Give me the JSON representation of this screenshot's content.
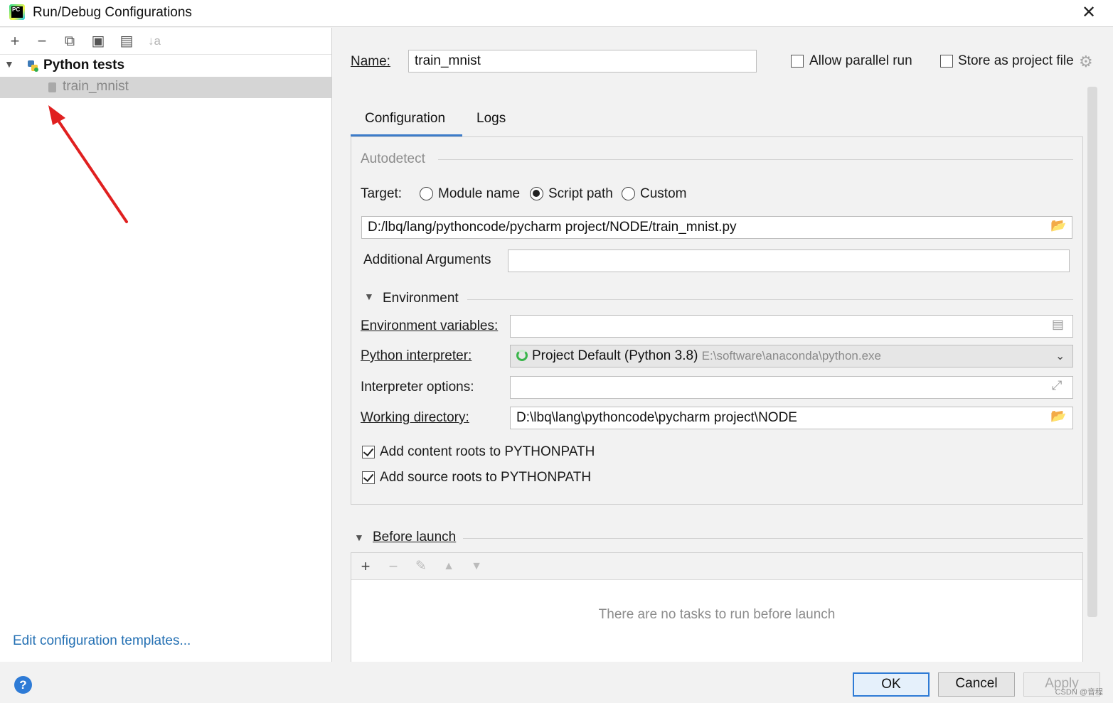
{
  "window": {
    "title": "Run/Debug Configurations",
    "close_label": "✕"
  },
  "left": {
    "toolbar": {
      "add": "+",
      "remove": "−",
      "copy": "⧉",
      "save": "▣",
      "folder": "▤",
      "sort": "↓a"
    },
    "tree": {
      "group_label": "Python tests",
      "item_label": "train_mnist"
    },
    "edit_templates_link": "Edit configuration templates..."
  },
  "form": {
    "name_label": "Name:",
    "name_value": "train_mnist",
    "allow_parallel_label": "Allow parallel run",
    "allow_parallel_checked": false,
    "store_project_label": "Store as project file",
    "store_project_checked": false,
    "tabs": [
      "Configuration",
      "Logs"
    ],
    "active_tab": "Configuration",
    "autodetect_label": "Autodetect",
    "target_label": "Target:",
    "target_options": [
      "Module name",
      "Script path",
      "Custom"
    ],
    "target_selected": "Script path",
    "script_path": "D:/lbq/lang/pythoncode/pycharm project/NODE/train_mnist.py",
    "additional_args_label": "Additional Arguments",
    "additional_args_value": "",
    "environment_label": "Environment",
    "env_vars_label": "Environment variables:",
    "env_vars_value": "",
    "python_interpreter_label": "Python interpreter:",
    "python_interpreter_value": "Project Default (Python 3.8)",
    "python_interpreter_path": "E:\\software\\anaconda\\python.exe",
    "interpreter_options_label": "Interpreter options:",
    "interpreter_options_value": "",
    "working_dir_label": "Working directory:",
    "working_dir_value": "D:\\lbq\\lang\\pythoncode\\pycharm project\\NODE",
    "add_content_roots_label": "Add content roots to PYTHONPATH",
    "add_content_roots_checked": true,
    "add_source_roots_label": "Add source roots to PYTHONPATH",
    "add_source_roots_checked": true,
    "before_launch_label": "Before launch",
    "before_launch_empty": "There are no tasks to run before launch"
  },
  "buttons": {
    "help": "?",
    "ok": "OK",
    "cancel": "Cancel",
    "apply": "Apply"
  },
  "watermark": "CSDN @音程",
  "colors": {
    "accent": "#2e7bd6",
    "annotation_arrow": "#e02020",
    "link": "#2470b3"
  }
}
